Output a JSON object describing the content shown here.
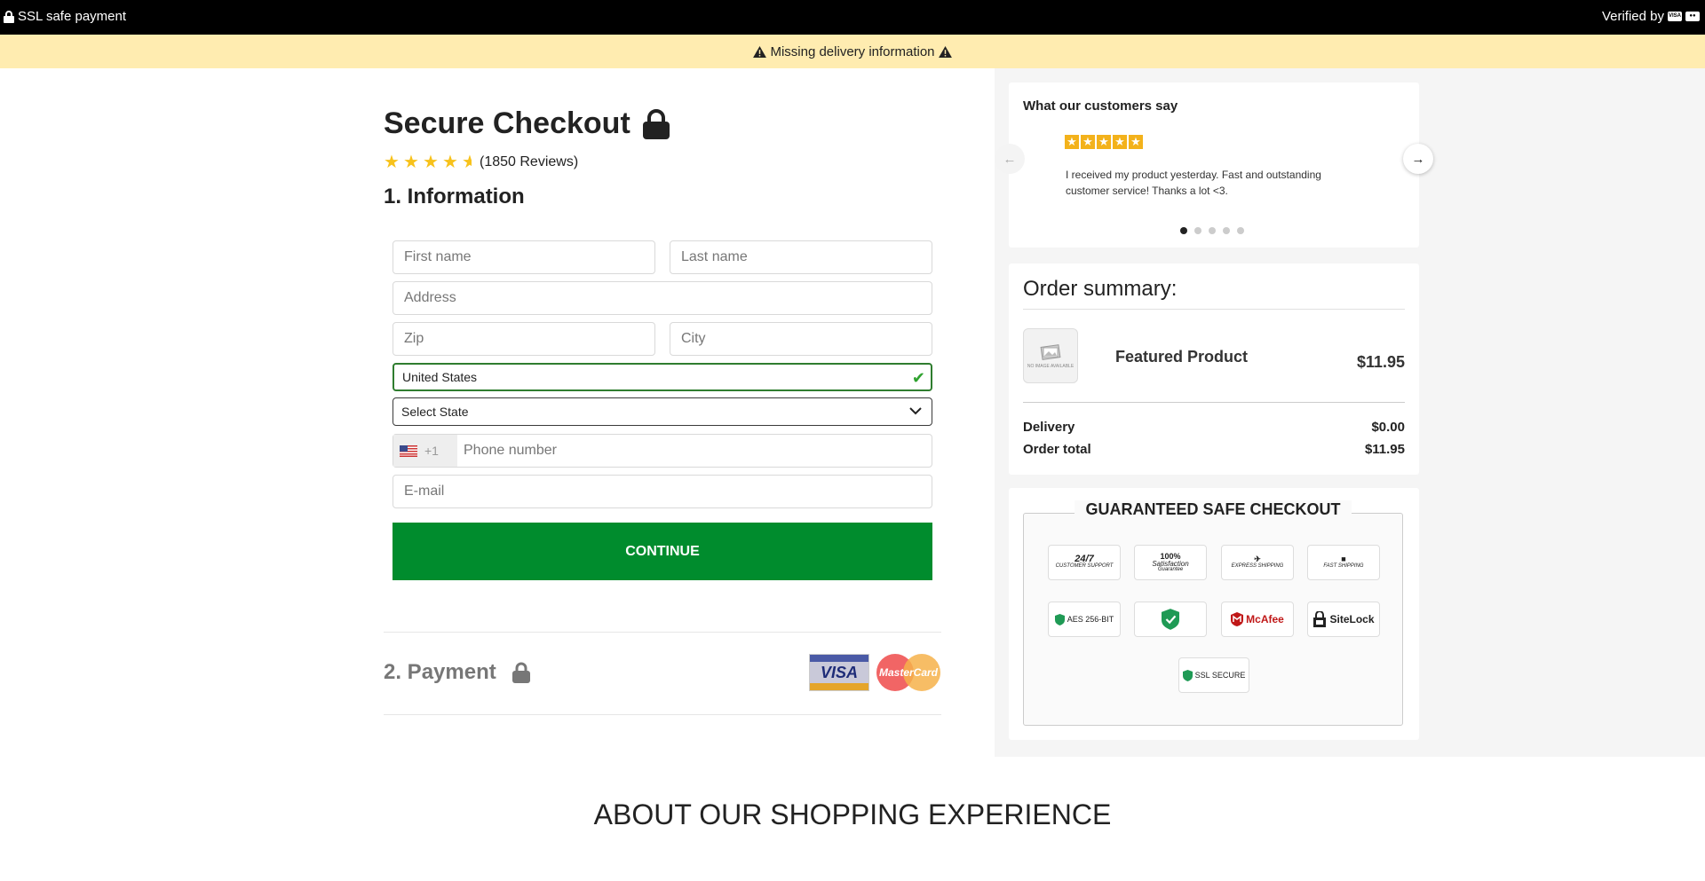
{
  "topbar": {
    "ssl_text": "SSL safe payment",
    "verified_text": "Verified by"
  },
  "warning": {
    "text": "Missing delivery information"
  },
  "checkout": {
    "title": "Secure Checkout",
    "rating_value": 4.5,
    "reviews_text": "(1850 Reviews)",
    "section1": "1. Information",
    "fields": {
      "first_name_placeholder": "First name",
      "last_name_placeholder": "Last name",
      "address_placeholder": "Address",
      "zip_placeholder": "Zip",
      "city_placeholder": "City",
      "country_value": "United States",
      "state_value": "Select State",
      "phone_code": "+1",
      "phone_placeholder": "Phone number",
      "email_placeholder": "E-mail"
    },
    "continue_label": "CONTINUE",
    "section2": "2. Payment",
    "card_logos": [
      "VISA",
      "MasterCard"
    ]
  },
  "testimonials": {
    "title": "What our customers say",
    "stars": 5,
    "text": "I received my product yesterday. Fast and outstanding customer service! Thanks a lot <3.",
    "dot_count": 5,
    "active_dot": 0
  },
  "summary": {
    "title": "Order summary:",
    "product_name": "Featured Product",
    "product_price": "$11.95",
    "thumb_text": "NO IMAGE AVAILABLE",
    "delivery_label": "Delivery",
    "delivery_value": "$0.00",
    "total_label": "Order total",
    "total_value": "$11.95"
  },
  "guarantee": {
    "title": "GUARANTEED SAFE CHECKOUT",
    "badges": {
      "support_main": "24/7",
      "support_sub": "CUSTOMER SUPPORT",
      "satisfaction_main": "100%",
      "satisfaction_mid": "Satisfaction",
      "satisfaction_sub": "Guarantee",
      "express_sub": "EXPRESS SHIPPING",
      "fast_sub": "FAST SHIPPING",
      "aes": "AES 256-BIT",
      "mcafee": "McAfee",
      "sitelock": "SiteLock",
      "ssl": "SSL SECURE"
    }
  },
  "footer": {
    "about_title": "ABOUT OUR SHOPPING EXPERIENCE"
  },
  "colors": {
    "continue_green": "#008c2d",
    "warning_bg": "#ffecb0",
    "star_yellow": "#f7c21b"
  }
}
